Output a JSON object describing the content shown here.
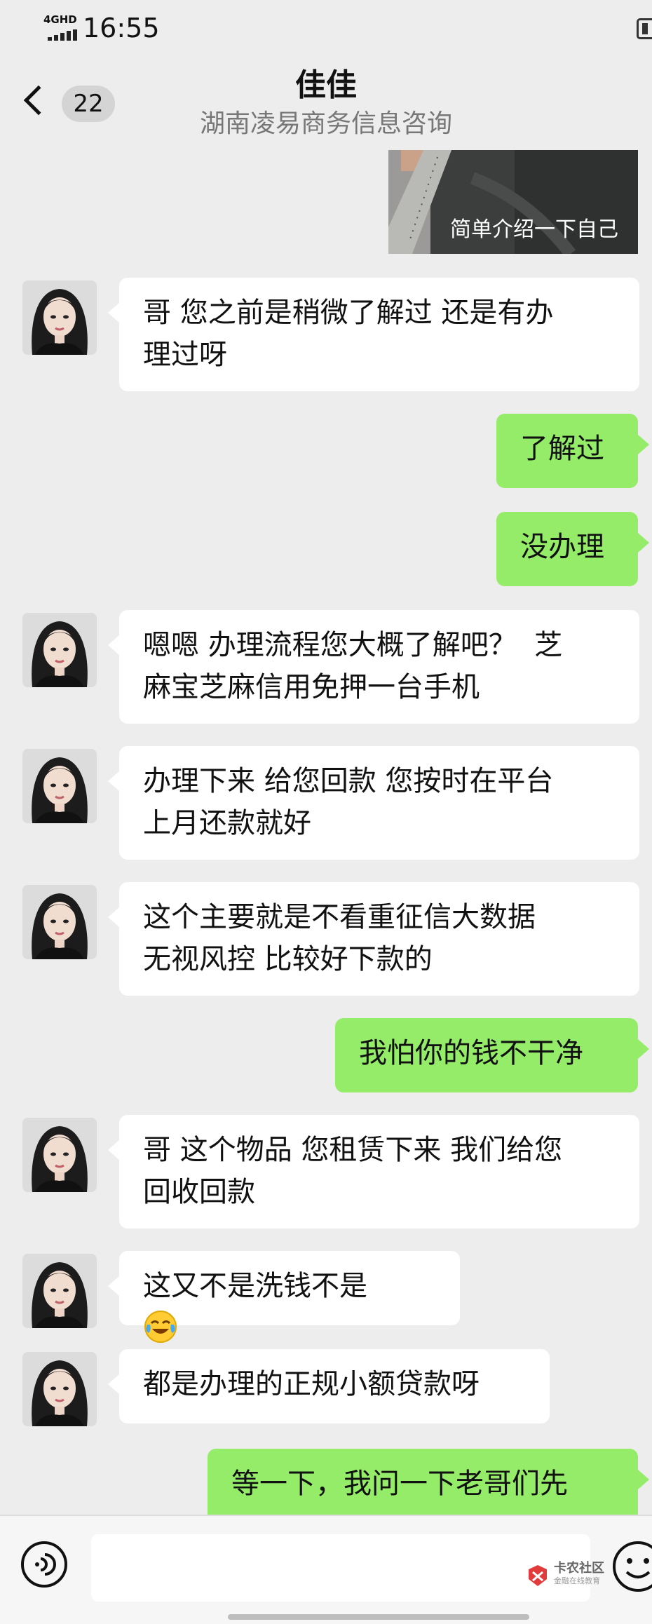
{
  "status_bar": {
    "network": "4GHD",
    "time": "16:55"
  },
  "header": {
    "unread_count": "22",
    "title": "佳佳",
    "subtitle": "湖南凌易商务信息咨询"
  },
  "image_message": {
    "caption": "简单介绍一下自己"
  },
  "messages": [
    {
      "side": "left",
      "lines": [
        "哥 您之前是稍微了解过 还是有办",
        "理过呀"
      ]
    },
    {
      "side": "right",
      "lines": [
        "了解过"
      ]
    },
    {
      "side": "right",
      "lines": [
        "没办理"
      ]
    },
    {
      "side": "left",
      "lines": [
        "嗯嗯 办理流程您大概了解吧？  芝",
        "麻宝芝麻信用免押一台手机"
      ]
    },
    {
      "side": "left",
      "lines": [
        "办理下来 给您回款 您按时在平台",
        "上月还款就好"
      ]
    },
    {
      "side": "left",
      "lines": [
        "这个主要就是不看重征信大数据",
        "无视风控 比较好下款的"
      ]
    },
    {
      "side": "right",
      "lines": [
        "我怕你的钱不干净"
      ]
    },
    {
      "side": "left",
      "lines": [
        "哥 这个物品 您租赁下来 我们给您",
        "回收回款"
      ]
    },
    {
      "side": "left",
      "lines": [
        "这又不是洗钱不是"
      ],
      "emoji": "crying-laughing-emoji"
    },
    {
      "side": "left",
      "lines": [
        "都是办理的正规小额贷款呀"
      ]
    },
    {
      "side": "right",
      "lines": [
        "等一下，我问一下老哥们先"
      ]
    }
  ],
  "watermark": {
    "name": "卡农社区",
    "sub": "金融在线教育"
  },
  "colors": {
    "background": "#ededed",
    "sent_bubble": "#95ec69",
    "received_bubble": "#ffffff"
  }
}
